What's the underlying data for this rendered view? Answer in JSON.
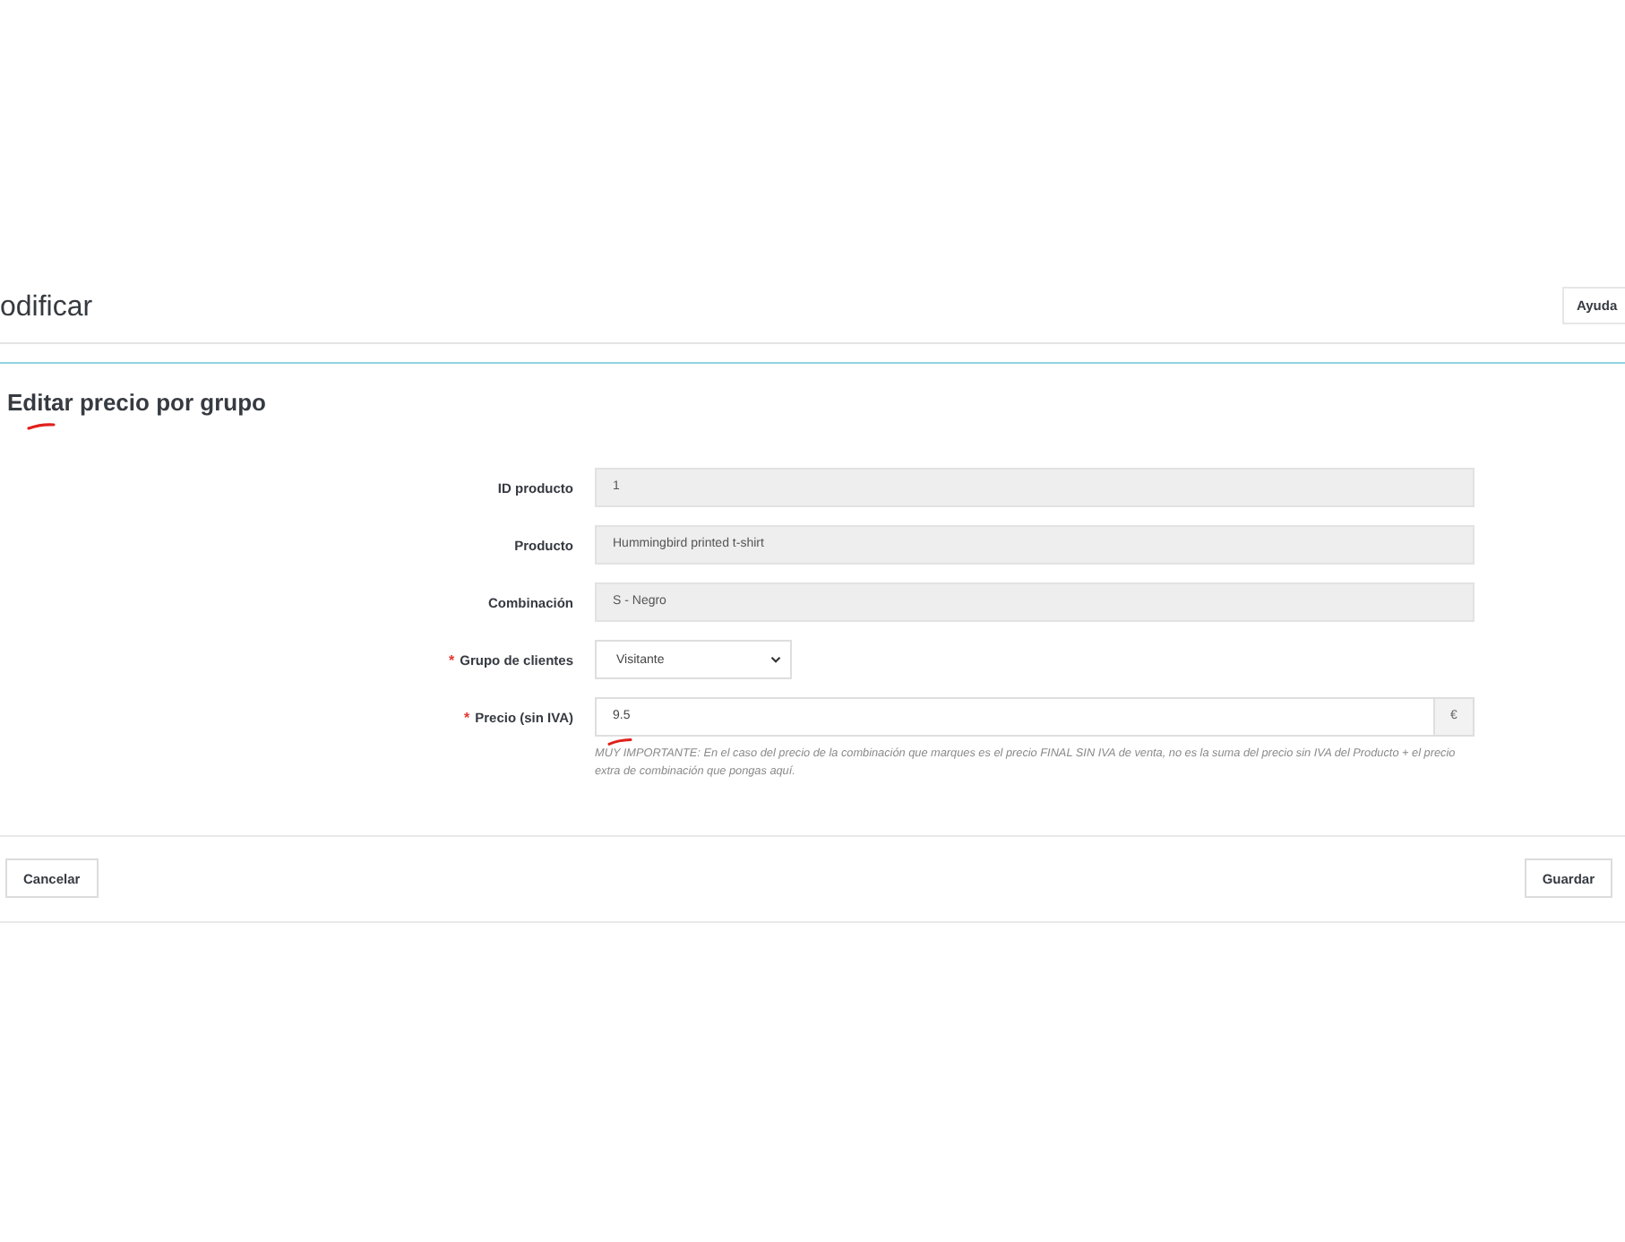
{
  "header": {
    "title": "odificar",
    "help_button": "Ayuda"
  },
  "card": {
    "title": "Editar precio por grupo",
    "fields": [
      {
        "kind": "readonly",
        "label": "ID producto",
        "value": "1"
      },
      {
        "kind": "readonly",
        "label": "Producto",
        "value": "Hummingbird printed t-shirt"
      },
      {
        "kind": "readonly",
        "label": "Combinación",
        "value": "S - Negro"
      },
      {
        "kind": "select",
        "required_mark": "*",
        "label": "Grupo de clientes",
        "value": "Visitante"
      },
      {
        "kind": "addon",
        "required_mark": "*",
        "label": "Precio (sin IVA)",
        "value": "9.5",
        "addon": "€",
        "help": "MUY IMPORTANTE: En el caso del precio de la combinación que marques es el precio FINAL SIN IVA de venta, no es la suma del precio sin IVA del Producto + el precio extra de combinación que pongas aquí."
      }
    ],
    "buttons": [
      {
        "kind": "cancel",
        "label": "Cancelar"
      },
      {
        "kind": "save",
        "label": "Guardar"
      }
    ]
  }
}
